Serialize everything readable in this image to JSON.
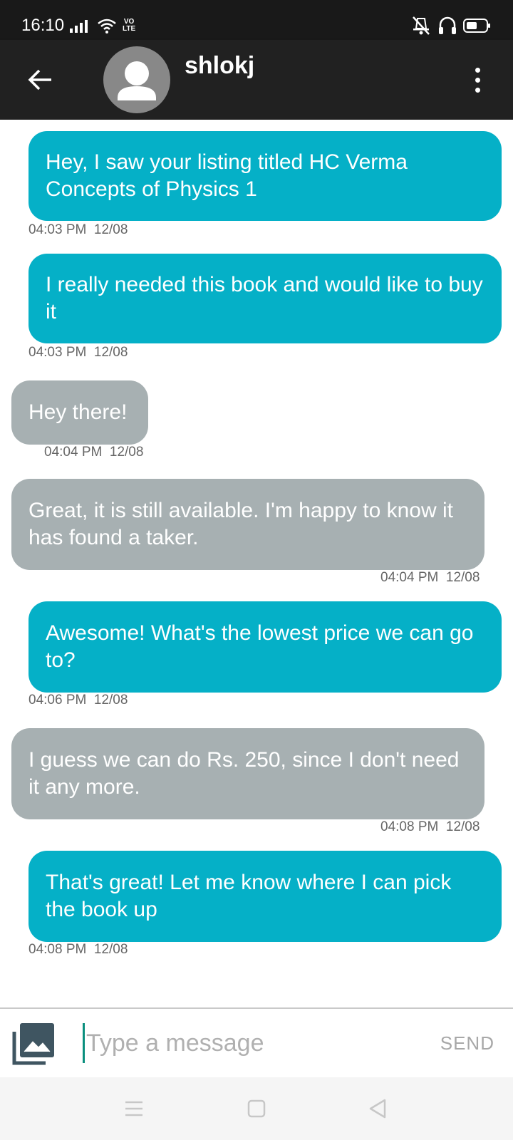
{
  "status_bar": {
    "time": "16:10",
    "volte_top": "VO",
    "volte_bottom": "LTE",
    "icons": [
      "signal-icon",
      "wifi-icon",
      "volte-icon",
      "mute-icon",
      "headphones-icon",
      "battery-icon"
    ]
  },
  "app_bar": {
    "back_icon": "arrow-back-icon",
    "contact_name": "shlokj",
    "menu_icon": "more-vert-icon",
    "background": "#212121"
  },
  "messages": [
    {
      "direction": "sent",
      "text": "Hey, I saw your listing titled HC Verma Concepts of Physics 1",
      "time": "04:03 PM",
      "date": "12/08"
    },
    {
      "direction": "sent",
      "text": "I really needed this book and would like to buy it",
      "time": "04:03 PM",
      "date": "12/08"
    },
    {
      "direction": "received",
      "text": "Hey there!",
      "time": "04:04 PM",
      "date": "12/08"
    },
    {
      "direction": "received",
      "text": "Great, it is still available. I'm happy to know it has found a taker.",
      "time": "04:04 PM",
      "date": "12/08"
    },
    {
      "direction": "sent",
      "text": "Awesome! What's the lowest price we can go to?",
      "time": "04:06 PM",
      "date": "12/08"
    },
    {
      "direction": "received",
      "text": "I guess we can do Rs. 250, since I don't need it any more.",
      "time": "04:08 PM",
      "date": "12/08"
    },
    {
      "direction": "sent",
      "text": "That's great! Let me know where I can pick the book up",
      "time": "04:08 PM",
      "date": "12/08"
    }
  ],
  "colors": {
    "sent_bubble": "#05b0c7",
    "received_bubble": "#a7b0b2",
    "cursor_accent": "#0a8f7e"
  },
  "input": {
    "gallery_icon": "gallery-icon",
    "value": "",
    "placeholder": "Type a message",
    "send_label": "SEND"
  },
  "nav_bar": {
    "icons": [
      "recent-apps-icon",
      "home-icon",
      "back-triangle-icon"
    ]
  }
}
